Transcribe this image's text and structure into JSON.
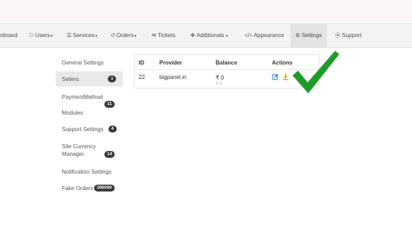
{
  "nav": {
    "items": [
      {
        "label": "nboard",
        "icon": ""
      },
      {
        "label": "Users",
        "icon": "users-icon"
      },
      {
        "label": "Services",
        "icon": "services-icon"
      },
      {
        "label": "Orders",
        "icon": "orders-icon"
      },
      {
        "label": "Tickets",
        "icon": "tickets-icon"
      },
      {
        "label": "Additionals",
        "icon": "additionals-icon"
      },
      {
        "label": "Appearance",
        "icon": "code-icon"
      },
      {
        "label": "Settings",
        "icon": "gear-icon"
      },
      {
        "label": "Support",
        "icon": "support-icon"
      }
    ]
  },
  "sidebar": {
    "items": [
      {
        "label": "General Settings"
      },
      {
        "label": "Sellers",
        "badge": "1"
      },
      {
        "label": "PaymentMethod",
        "badge": "11"
      },
      {
        "label": "Modules"
      },
      {
        "label": "Support Settings",
        "badge": "4"
      },
      {
        "label": "Site Currency Manager",
        "line1": "Site Currency",
        "line2": "Manager",
        "badge": "14"
      },
      {
        "label": "Notification Settings"
      },
      {
        "label": "Fake Orders",
        "badge": "396099"
      }
    ]
  },
  "table": {
    "headers": {
      "id": "ID",
      "provider": "Provider",
      "balance": "Balance",
      "actions": "Actions"
    },
    "rows": [
      {
        "id": "22",
        "provider": "bigpanel.in",
        "balance": "₹ 0",
        "balance_sub": "₹ 0"
      }
    ]
  },
  "colors": {
    "check": "#1f9b28",
    "edit": "#2e86d4",
    "download": "#f0a020"
  }
}
